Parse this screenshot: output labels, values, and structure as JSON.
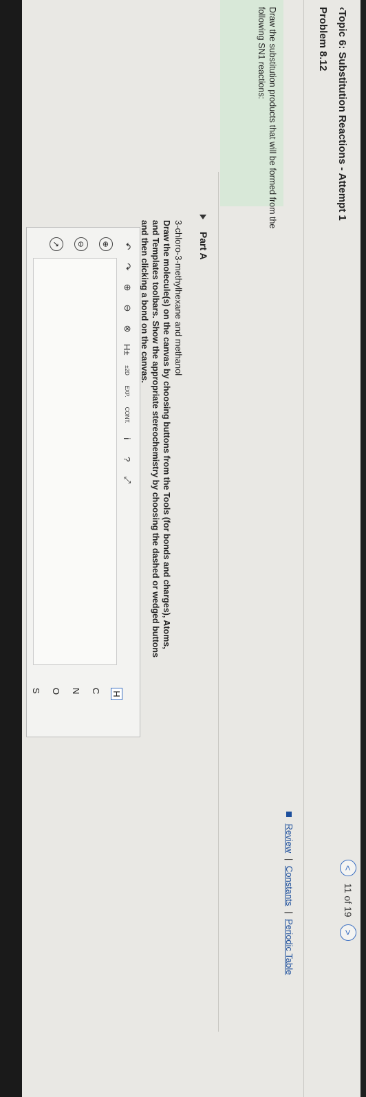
{
  "header": {
    "title": "‹Topic 6: Substitution Reactions - Attempt 1",
    "problem": "Problem 8.12",
    "nav_prev": "<",
    "nav_count": "11 of 19",
    "nav_next": ">"
  },
  "links": {
    "review": "Review",
    "constants": "Constants",
    "periodic_table": "Periodic Table",
    "sep": "|"
  },
  "intro": "Draw the substitution products that will be formed from the following SN1 reactions:",
  "part": {
    "label": "Part A",
    "reagents": "3-chloro-3-methylhexane and methanol",
    "instructions": "Draw the molecule(s) on the canvas by choosing buttons from the Tools (for bonds and charges), Atoms, and Templates toolbars. Show the appropriate stereochemistry by choosing the dashed or wedged buttons and then clicking a bond on the canvas."
  },
  "toolbar": {
    "undo": "↶",
    "redo": "↷",
    "plus": "⊕",
    "minus": "⊖",
    "clear": "⊗",
    "h_plus": "H±",
    "twod": "±2D",
    "exp": "EXP.",
    "cont": "CONT.",
    "info": "i",
    "help": "?",
    "expand": "⤢"
  },
  "atoms": [
    "H",
    "C",
    "N",
    "O",
    "S"
  ],
  "left_tools": [
    "⊕",
    "⊖",
    "↗"
  ]
}
